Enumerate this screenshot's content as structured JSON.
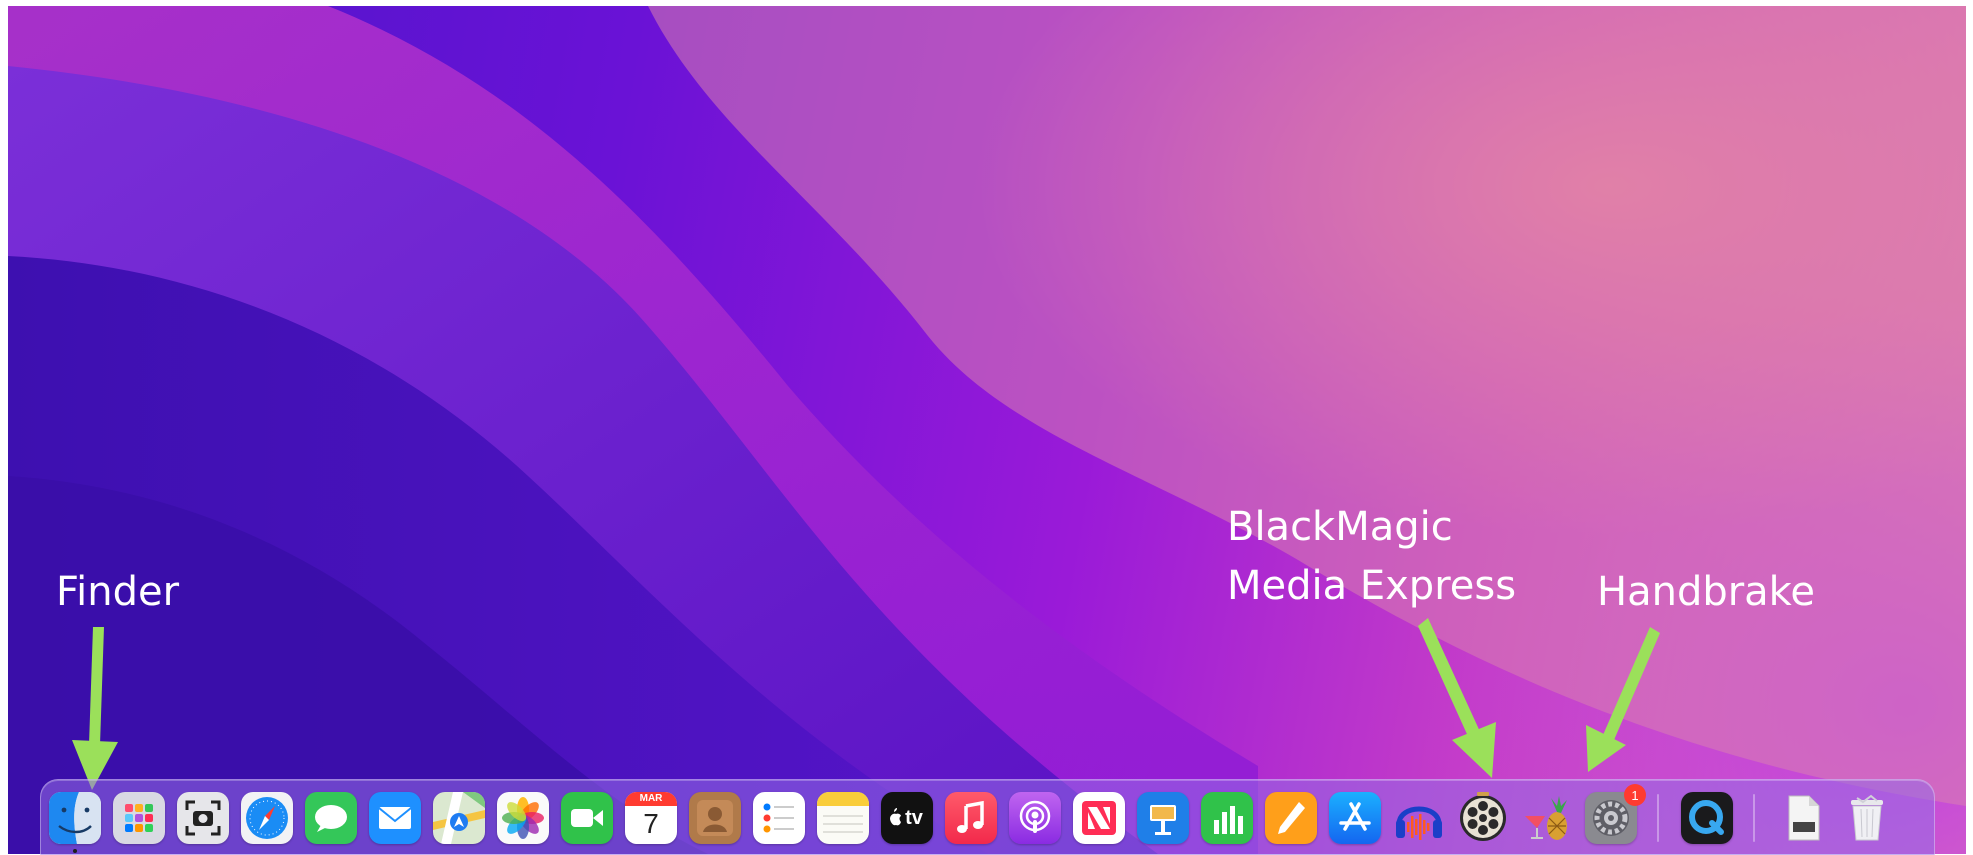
{
  "annotations": {
    "finder": "Finder",
    "blackmagic_line1": "BlackMagic",
    "blackmagic_line2": "Media Express",
    "handbrake": "Handbrake"
  },
  "colors": {
    "arrow": "#9be05a",
    "callout_text": "#ffffff",
    "badge": "#ff3b30"
  },
  "dock": {
    "apps": [
      {
        "name": "Finder",
        "icon": "finder-icon",
        "running": true
      },
      {
        "name": "Launchpad",
        "icon": "launchpad-icon"
      },
      {
        "name": "Screenshot",
        "icon": "screenshot-icon"
      },
      {
        "name": "Safari",
        "icon": "safari-icon"
      },
      {
        "name": "Messages",
        "icon": "messages-icon"
      },
      {
        "name": "Mail",
        "icon": "mail-icon"
      },
      {
        "name": "Maps",
        "icon": "maps-icon"
      },
      {
        "name": "Photos",
        "icon": "photos-icon"
      },
      {
        "name": "FaceTime",
        "icon": "facetime-icon"
      },
      {
        "name": "Calendar",
        "icon": "calendar-icon"
      },
      {
        "name": "Contacts",
        "icon": "contacts-icon"
      },
      {
        "name": "Reminders",
        "icon": "reminders-icon"
      },
      {
        "name": "Notes",
        "icon": "notes-icon"
      },
      {
        "name": "TV",
        "icon": "tv-icon"
      },
      {
        "name": "Music",
        "icon": "music-icon"
      },
      {
        "name": "Podcasts",
        "icon": "podcasts-icon"
      },
      {
        "name": "News",
        "icon": "news-icon"
      },
      {
        "name": "Keynote",
        "icon": "keynote-icon"
      },
      {
        "name": "Numbers",
        "icon": "numbers-icon"
      },
      {
        "name": "Pages",
        "icon": "pages-icon"
      },
      {
        "name": "App Store",
        "icon": "app-store-icon"
      },
      {
        "name": "Audacity",
        "icon": "audacity-icon"
      },
      {
        "name": "Blackmagic Media Express",
        "icon": "media-express-icon"
      },
      {
        "name": "HandBrake",
        "icon": "handbrake-icon"
      },
      {
        "name": "System Preferences",
        "icon": "system-preferences-icon"
      },
      {
        "name": "QuickTime Player",
        "icon": "quicktime-icon"
      },
      {
        "name": "Document",
        "icon": "document-icon"
      },
      {
        "name": "Trash",
        "icon": "trash-icon"
      }
    ],
    "calendar": {
      "month": "MAR",
      "day": "7"
    },
    "tv": {
      "label": "tv"
    },
    "system_preferences_badge": "1"
  }
}
